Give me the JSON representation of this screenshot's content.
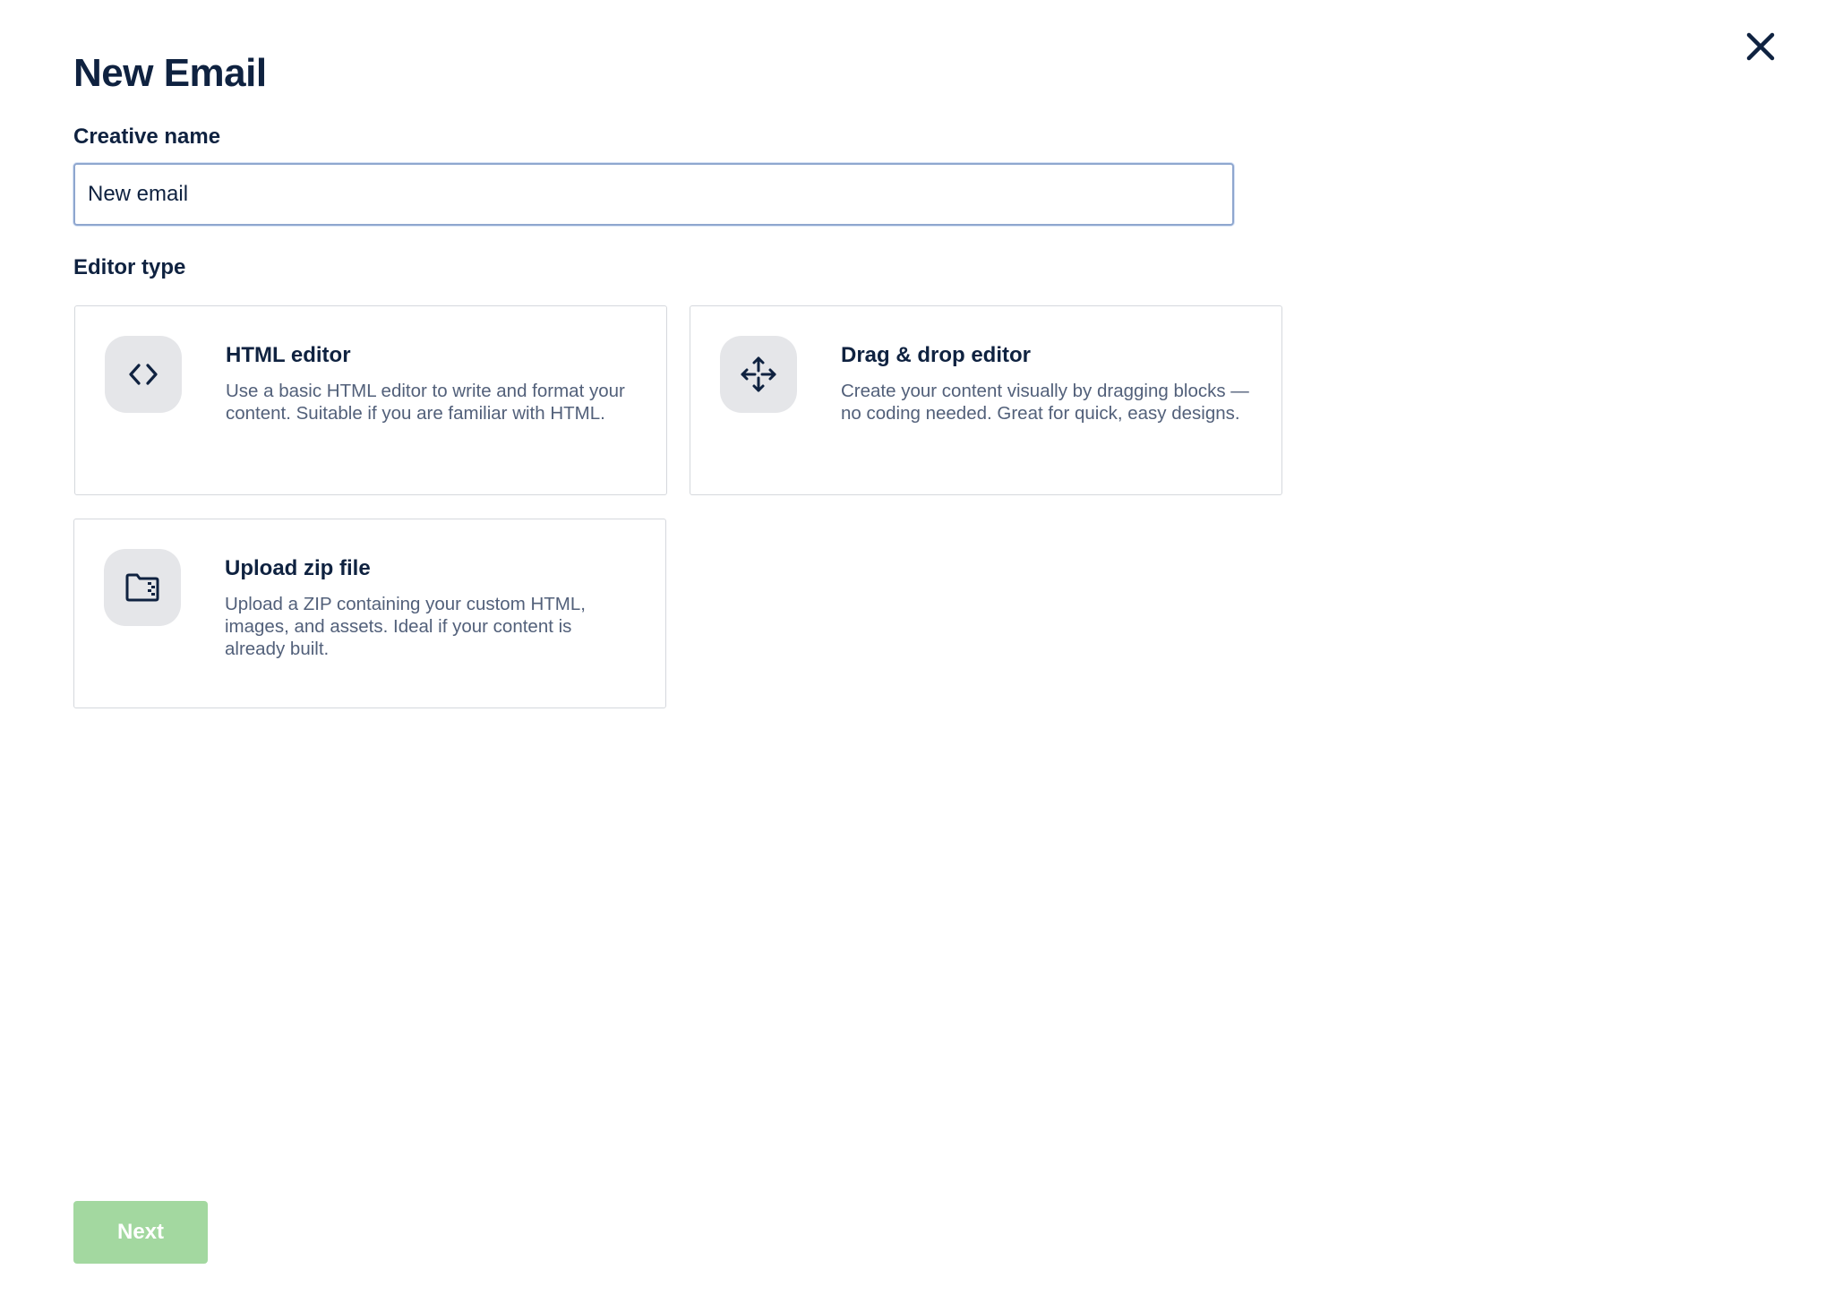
{
  "header": {
    "title": "New Email",
    "close_icon": "close-icon"
  },
  "form": {
    "creative_name_label": "Creative name",
    "creative_name_value": "New email",
    "editor_type_label": "Editor type"
  },
  "editor_options": [
    {
      "icon": "code-icon",
      "title": "HTML editor",
      "description": "Use a basic HTML editor to write and format your content. Suitable if you are familiar with HTML."
    },
    {
      "icon": "move-arrows-icon",
      "title": "Drag & drop editor",
      "description": "Create your content visually by dragging blocks — no coding needed. Great for quick, easy designs."
    },
    {
      "icon": "zip-folder-icon",
      "title": "Upload zip file",
      "description": "Upload a ZIP containing your custom HTML, images, and assets. Ideal if your content is already built."
    }
  ],
  "footer": {
    "next_label": "Next",
    "next_color": "#a3d8a0"
  },
  "colors": {
    "text_primary": "#0f2240",
    "text_secondary": "#52607a",
    "icon_bg": "#e5e6e9",
    "input_border": "#8fa7cf"
  }
}
